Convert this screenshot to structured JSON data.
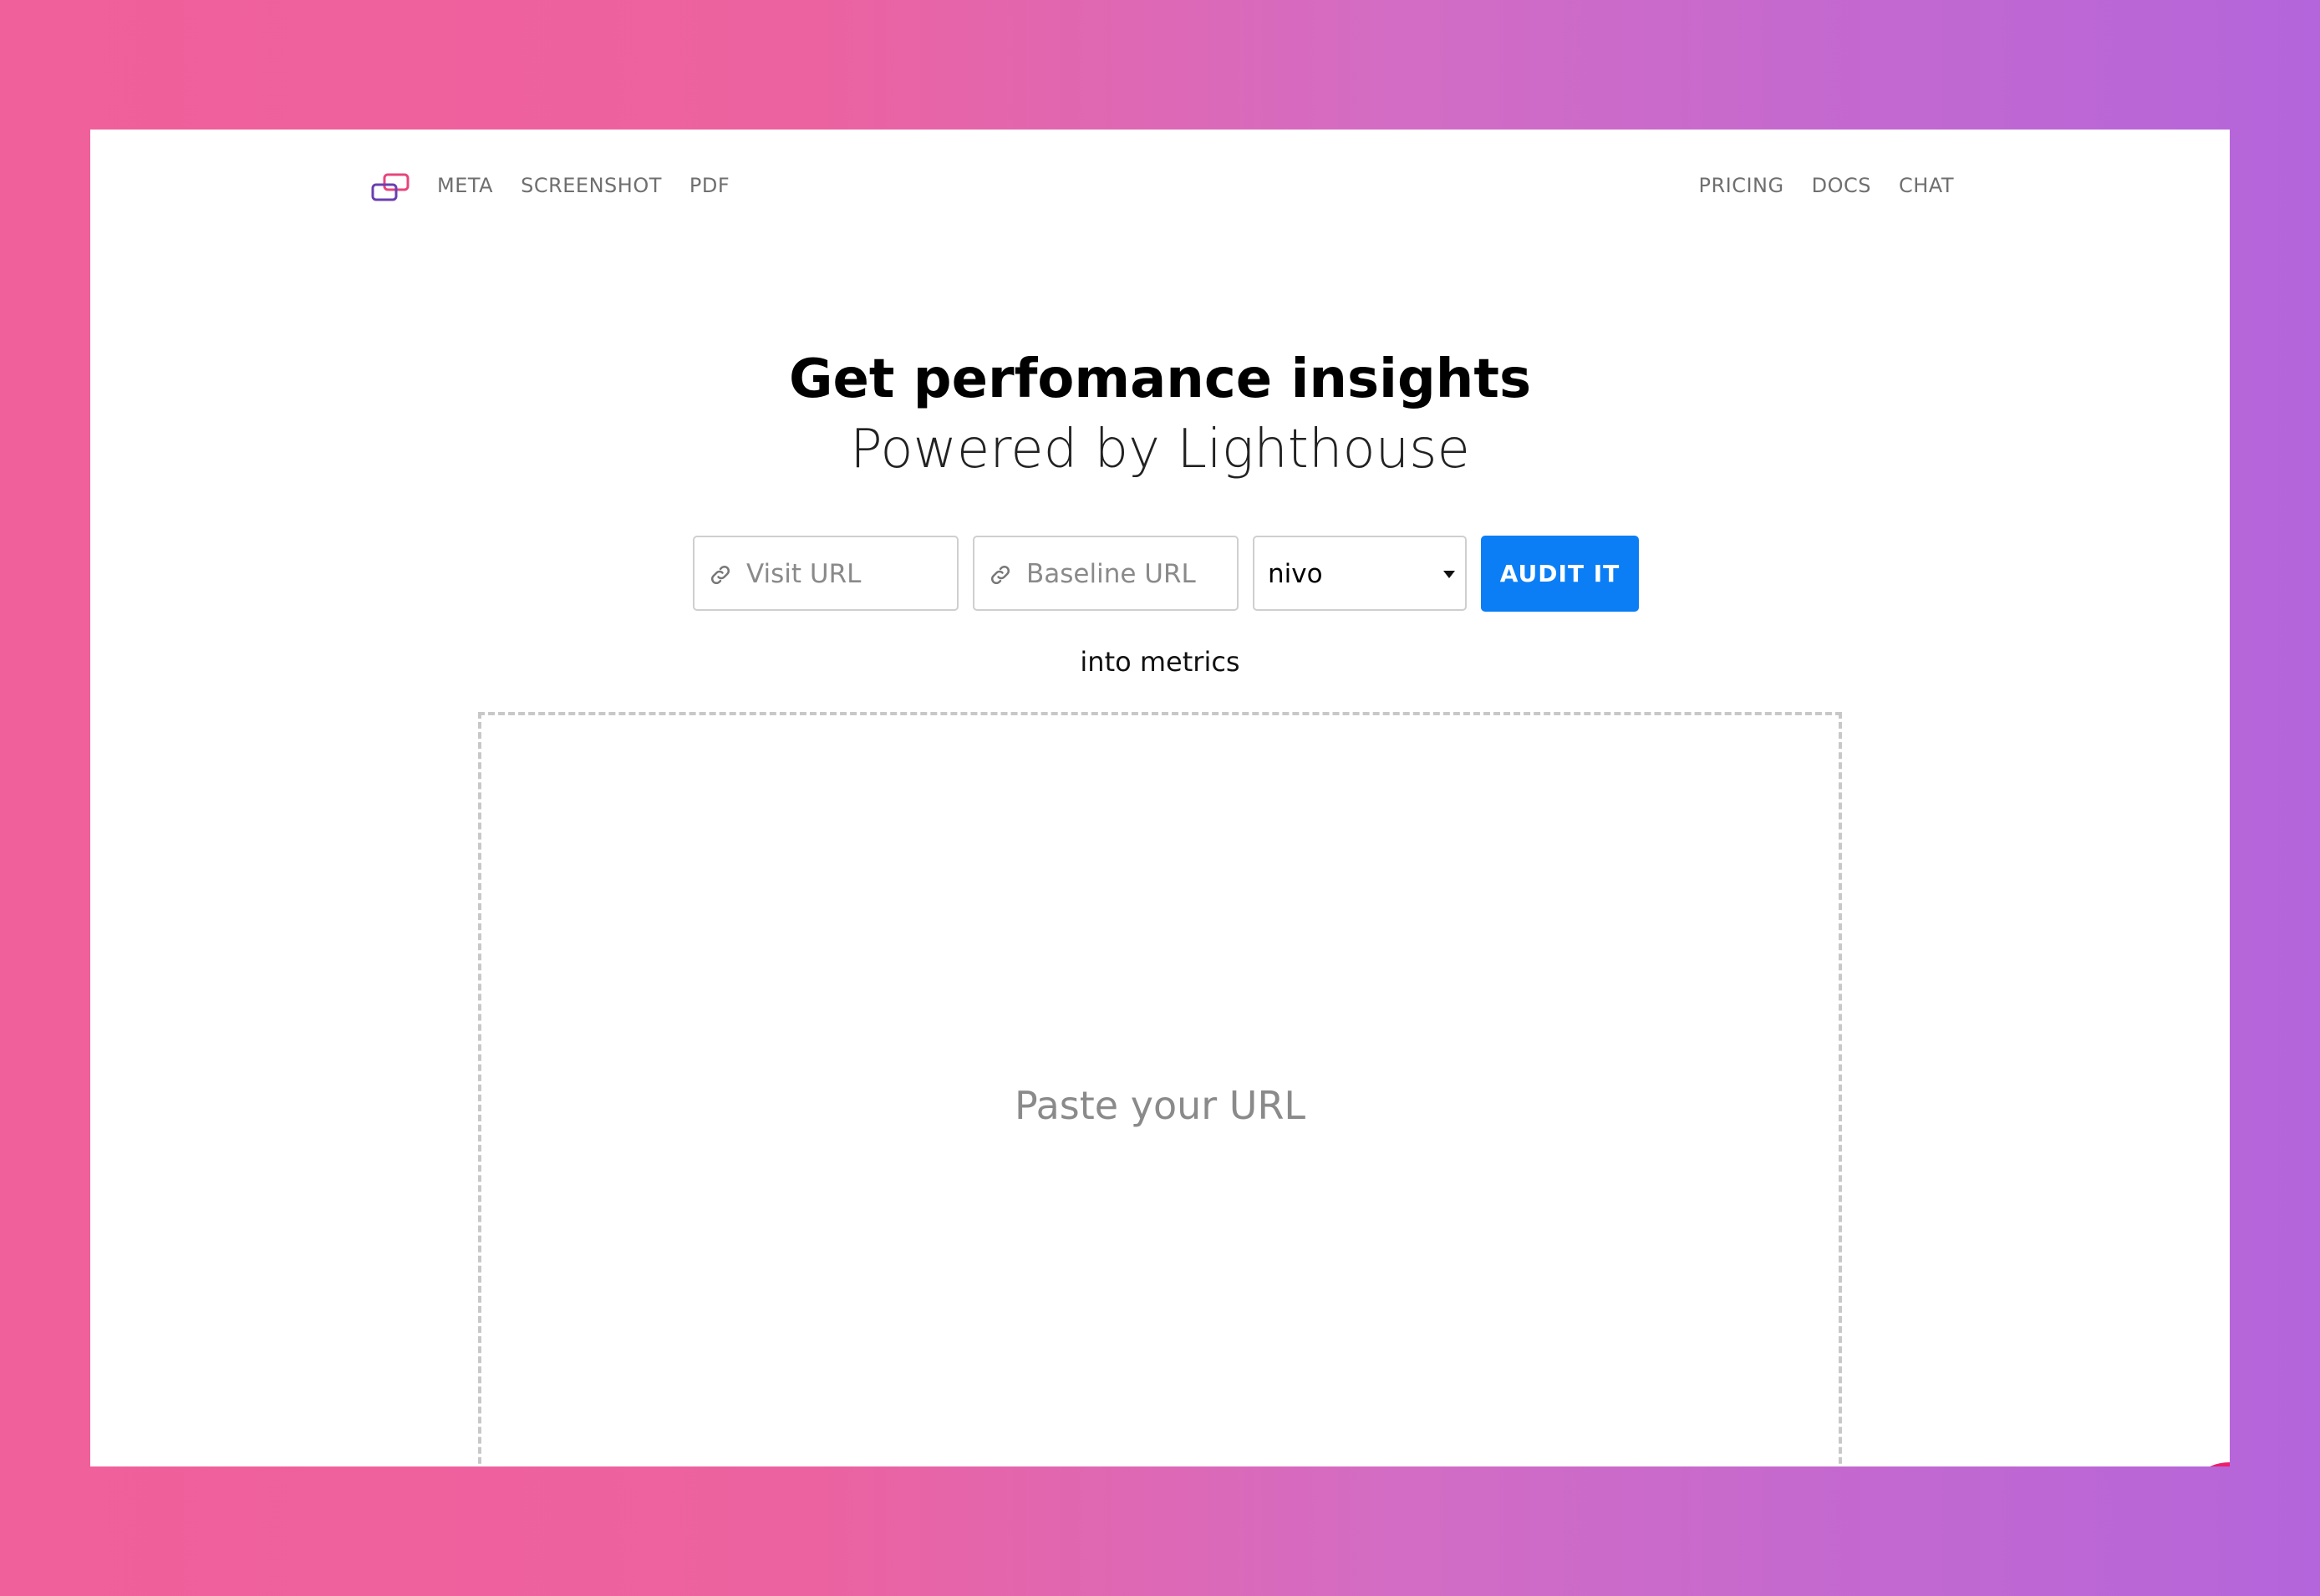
{
  "nav": {
    "left_items": [
      "META",
      "SCREENSHOT",
      "PDF"
    ],
    "right_items": [
      "PRICING",
      "DOCS",
      "CHAT"
    ]
  },
  "hero": {
    "title": "Get perfomance insights",
    "subtitle": "Powered by Lighthouse"
  },
  "form": {
    "visit_placeholder": "Visit URL",
    "baseline_placeholder": "Baseline URL",
    "select_value": "nivo",
    "submit_label": "AUDIT IT"
  },
  "caption": "into metrics",
  "dropzone": {
    "placeholder": "Paste your URL"
  },
  "colors": {
    "accent": "#0b7ef6",
    "chat": "#ec1e6d"
  },
  "icons": [
    "logo-icon",
    "link-icon",
    "chevron-down-icon",
    "chat-icon"
  ]
}
